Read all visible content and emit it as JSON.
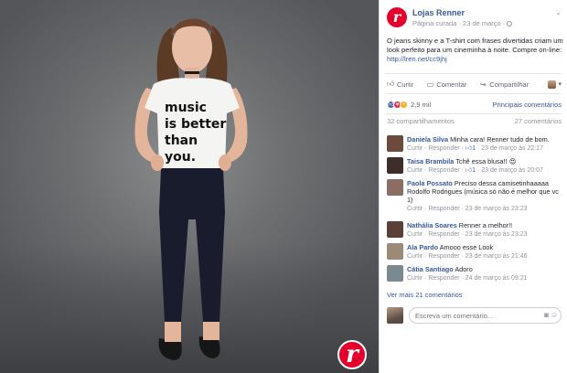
{
  "photo": {
    "shirt_text": [
      "music",
      "is better",
      "than",
      "you."
    ],
    "watermark_letter": "r"
  },
  "post": {
    "page_name": "Lojas Renner",
    "logo_letter": "r",
    "meta": "Página curada · 23 de março ·",
    "text": "O jeans skinny e a T-shirt com frases divertidas criam um look perfeito para um cineminha à noite. Compre on-line:",
    "link": "http://lren.net/cc9jhj"
  },
  "actions": {
    "like": "Curtir",
    "comment": "Comentar",
    "share": "Compartilhar"
  },
  "reactions": {
    "count": "2,9 mil",
    "relevant": "Principais comentários"
  },
  "counts": {
    "shares": "32 compartilhamentos",
    "comments": "27 comentários"
  },
  "comments": [
    {
      "name": "Daniela Silva",
      "text": "Minha cara! Renner tudo de bom.",
      "reply": "Curtir · Responder · ",
      "likes": "1",
      "time": " · 23 de março às 22:17",
      "avatar": "#6b4b3c"
    },
    {
      "name": "Taisa Brambila",
      "text": "Tchê essa blusa!! 😍",
      "reply": "Curtir · Responder · ",
      "likes": "1",
      "time": " · 23 de março às 20:07",
      "avatar": "#3d2e2a"
    },
    {
      "name": "Paola Possato",
      "text": "Preciso dessa camisetinhaaaaa Rodolfo Rodrigues (música só não é melhor que vc 1)",
      "reply": "Curtir · Responder · ",
      "likes": "",
      "time": "23 de março às 23:23",
      "avatar": "#8a6d63"
    },
    {
      "name": "Nathália Soares",
      "text": "Renner a melhor!!",
      "reply": "Curtir · Responder · ",
      "likes": "",
      "time": "23 de março às 23:23",
      "avatar": "#5a4038"
    },
    {
      "name": "Ala Pardo",
      "text": "Amooo esse Look",
      "reply": "Curtir · Responder · ",
      "likes": "",
      "time": "23 de março às 21:46",
      "avatar": "#9a8a78"
    },
    {
      "name": "Cátia Santiago",
      "text": "Adoro",
      "reply": "Curtir · Responder · ",
      "likes": "",
      "time": "24 de março às 09:21",
      "avatar": "#7a8a90"
    }
  ],
  "more_comments": "Ver mais 21 comentários",
  "composer": {
    "placeholder": "Escreva um comentário..."
  },
  "colors": {
    "brand_red": "#e4002b",
    "fb_link": "#365899",
    "fb_like": "#4267b2"
  }
}
